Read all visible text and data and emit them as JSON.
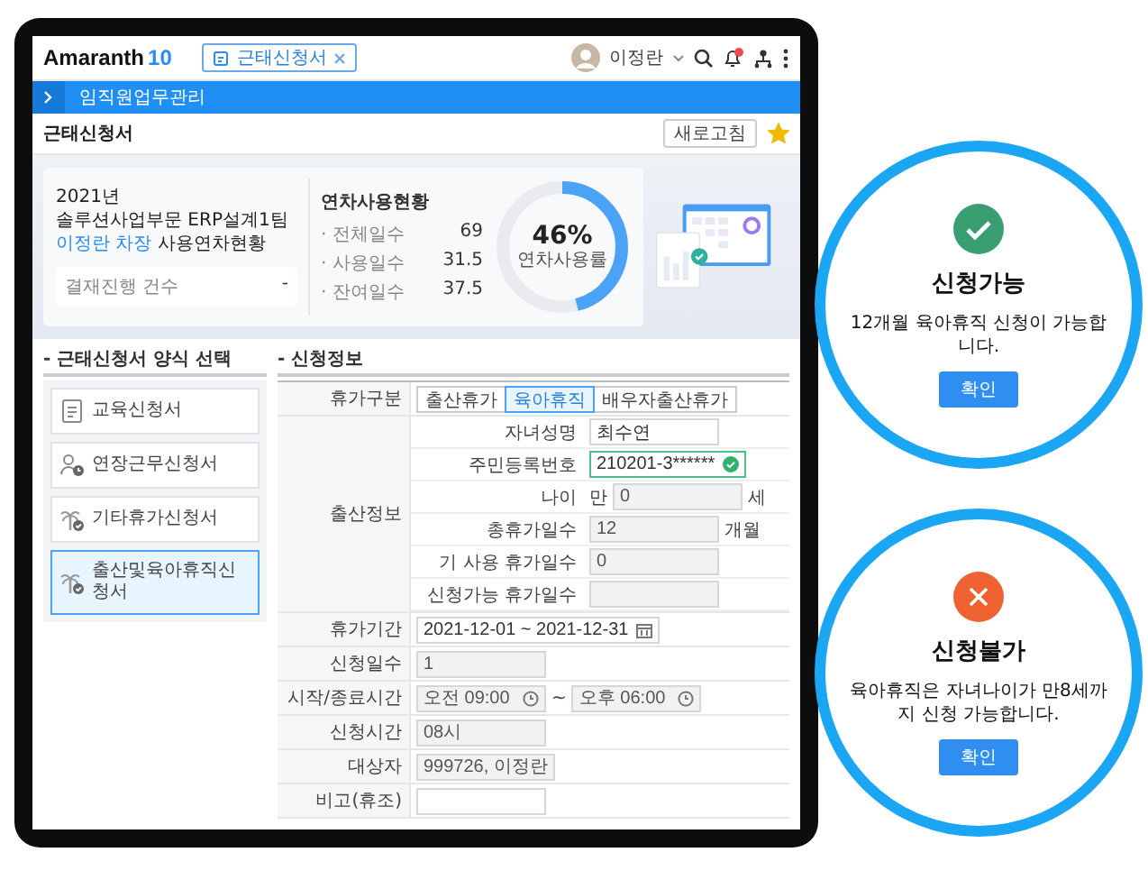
{
  "app": {
    "logo": "Amaranth",
    "version": "10"
  },
  "tabs": [
    {
      "label": "근태신청서",
      "selected": true
    }
  ],
  "user": {
    "name": "이정란"
  },
  "menu_bar": {
    "title": "임직원업무관리"
  },
  "page": {
    "title": "근태신청서",
    "buttons": [
      "새로고침"
    ],
    "favorite": true
  },
  "summary": {
    "year": "2021년",
    "department": "솔루션사업부문 ERP설계1팀",
    "heading": "**이정란 차장** 사용연차현황",
    "approval": {
      "label": "결재진행 건수",
      "value": "-"
    },
    "usage": {
      "title": "연차사용현황",
      "stats": [
        {
          "label": "· 전체일수",
          "value": "69"
        },
        {
          "label": "· 사용일수",
          "value": "31.5"
        },
        {
          "label": "· 잔여일수",
          "value": "37.5"
        }
      ],
      "rate": "46%",
      "rate_label": "연차사용률",
      "level": 0.46
    }
  },
  "form_list": {
    "title": "- 근태신청서 양식 선택",
    "items": [
      {
        "label": "교육신청서",
        "kind": "document",
        "selected": false
      },
      {
        "label": "연장근무신청서",
        "kind": "person",
        "selected": false
      },
      {
        "label": "기타휴가신청서",
        "kind": "tree",
        "selected": false
      },
      {
        "label": "출산및육아휴직신청서",
        "kind": "tree",
        "selected": true
      }
    ]
  },
  "application": {
    "title": "- 신청정보",
    "leave_type": {
      "label": "휴가구분",
      "options": [
        {
          "label": "출산휴가",
          "selected": false
        },
        {
          "label": "육아휴직",
          "selected": true
        },
        {
          "label": "배우자출산휴가",
          "selected": false
        }
      ]
    },
    "birth_info": {
      "label": "출산정보",
      "fields": [
        {
          "label": "자녀성명",
          "kind": "input",
          "value": "최수연"
        },
        {
          "label": "주민등록번호",
          "kind": "verified",
          "value": "210201-3******"
        },
        {
          "label": "나이",
          "kind": "readonly",
          "prefix": "만",
          "value": "0",
          "unit": "세"
        },
        {
          "label": "총휴가일수",
          "kind": "readonly",
          "value": "12",
          "unit": "개월"
        },
        {
          "label": "기 사용 휴가일수",
          "kind": "readonly",
          "value": "0"
        },
        {
          "label": "신청가능 휴가일수",
          "kind": "readonly"
        }
      ]
    },
    "rows": [
      {
        "label": "휴가기간",
        "kind": "date-range",
        "value": "2021-12-01 ~ 2021-12-31"
      },
      {
        "label": "신청일수",
        "kind": "readonly",
        "value": "1"
      },
      {
        "label": "시작/종료시간",
        "kind": "time-range",
        "values": [
          "오전 09:00",
          "오후 06:00"
        ],
        "separator": "~"
      },
      {
        "label": "신청시간",
        "kind": "readonly",
        "value": "08시"
      },
      {
        "label": "대상자",
        "kind": "readonly",
        "value": "999726, 이정란"
      },
      {
        "label": "비고(휴조)",
        "kind": "input"
      }
    ]
  },
  "dialogs": [
    {
      "kind": "success",
      "title": "신청가능",
      "message": "12개월 육아휴직 신청이 가능합니다.",
      "button": "확인"
    },
    {
      "kind": "error",
      "title": "신청불가",
      "message": "육아휴직은 자녀나이가 만8세까지 신청 가능합니다.",
      "button": "확인"
    }
  ]
}
